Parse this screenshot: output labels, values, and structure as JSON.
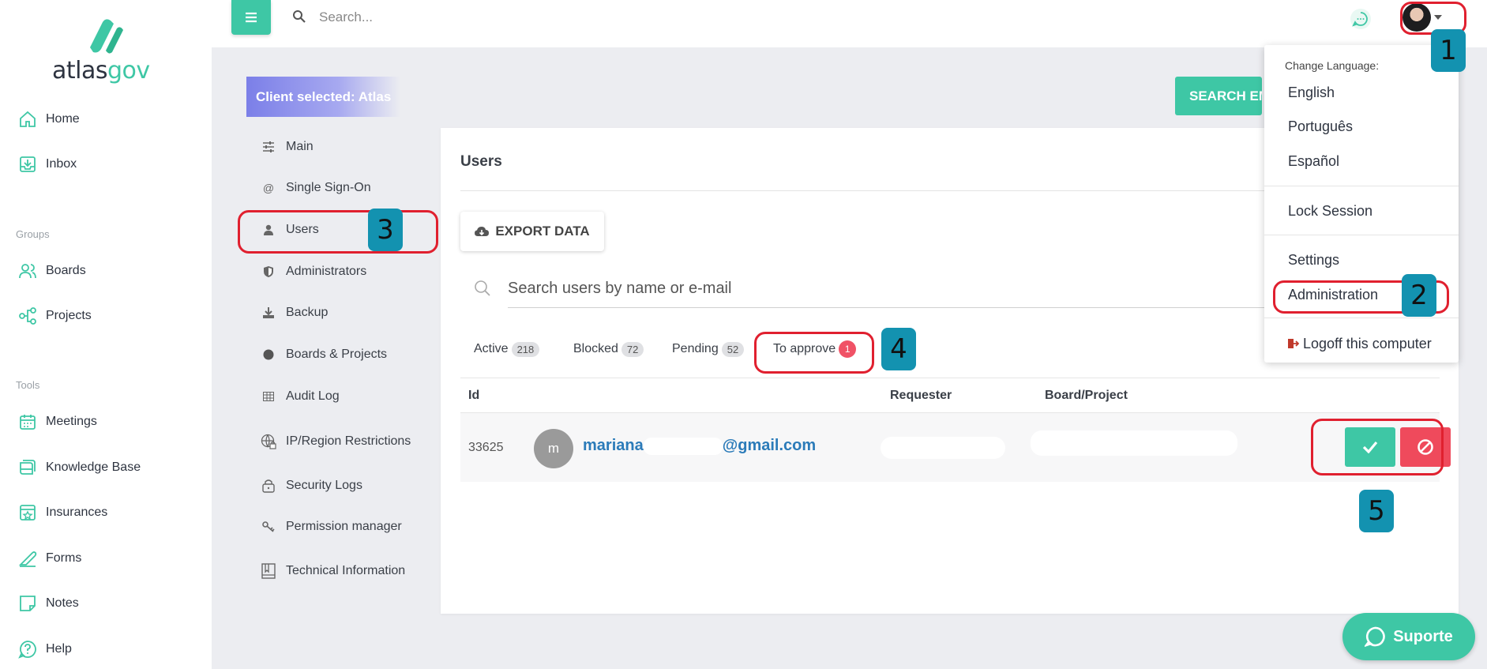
{
  "brand": {
    "logo_main": "atlas",
    "logo_accent": "gov",
    "accent_color": "#3ec7a5"
  },
  "sidebar": {
    "items": [
      {
        "label": "Home",
        "icon": "home-icon"
      },
      {
        "label": "Inbox",
        "icon": "inbox-icon"
      }
    ],
    "groups_label": "Groups",
    "group_items": [
      {
        "label": "Boards",
        "icon": "users-icon"
      },
      {
        "label": "Projects",
        "icon": "projects-icon"
      }
    ],
    "tools_label": "Tools",
    "tool_items": [
      {
        "label": "Meetings",
        "icon": "calendar-icon"
      },
      {
        "label": "Knowledge Base",
        "icon": "book-icon"
      },
      {
        "label": "Insurances",
        "icon": "insurance-icon"
      },
      {
        "label": "Forms",
        "icon": "forms-icon"
      },
      {
        "label": "Notes",
        "icon": "notes-icon"
      },
      {
        "label": "Help",
        "icon": "help-icon"
      }
    ]
  },
  "topbar": {
    "search_placeholder": "Search..."
  },
  "client_banner": "Client selected: Atlas",
  "search_employee_button": "SEARCH EM",
  "settings_menu": [
    {
      "label": "Main",
      "icon": "sliders-icon"
    },
    {
      "label": "Single Sign-On",
      "icon": "at-icon"
    },
    {
      "label": "Users",
      "icon": "user-icon"
    },
    {
      "label": "Administrators",
      "icon": "shield-icon"
    },
    {
      "label": "Backup",
      "icon": "download-icon"
    },
    {
      "label": "Boards & Projects",
      "icon": "circle-icon"
    },
    {
      "label": "Audit Log",
      "icon": "table-icon"
    },
    {
      "label": "IP/Region Restrictions",
      "icon": "globe-lock-icon"
    },
    {
      "label": "Security Logs",
      "icon": "lock-icon"
    },
    {
      "label": "Permission manager",
      "icon": "key-icon"
    },
    {
      "label": "Technical Information",
      "icon": "book-icon"
    }
  ],
  "users_panel": {
    "title": "Users",
    "export_label": "EXPORT DATA",
    "search_placeholder": "Search users by name or e-mail",
    "tabs": [
      {
        "label": "Active",
        "count": "218"
      },
      {
        "label": "Blocked",
        "count": "72"
      },
      {
        "label": "Pending",
        "count": "52"
      },
      {
        "label": "To approve",
        "count": "1"
      }
    ],
    "columns": [
      "Id",
      "Requester",
      "Board/Project"
    ],
    "rows": [
      {
        "id": "33625",
        "avatar_letter": "m",
        "email_start": "mariana",
        "email_end": "@gmail.com"
      }
    ]
  },
  "user_dropdown": {
    "heading": "Change Language:",
    "languages": [
      "English",
      "Português",
      "Español"
    ],
    "lock": "Lock Session",
    "settings": "Settings",
    "administration": "Administration",
    "logoff": "Logoff this computer"
  },
  "annotations": [
    "1",
    "2",
    "3",
    "4",
    "5"
  ],
  "support_button": "Suporte"
}
